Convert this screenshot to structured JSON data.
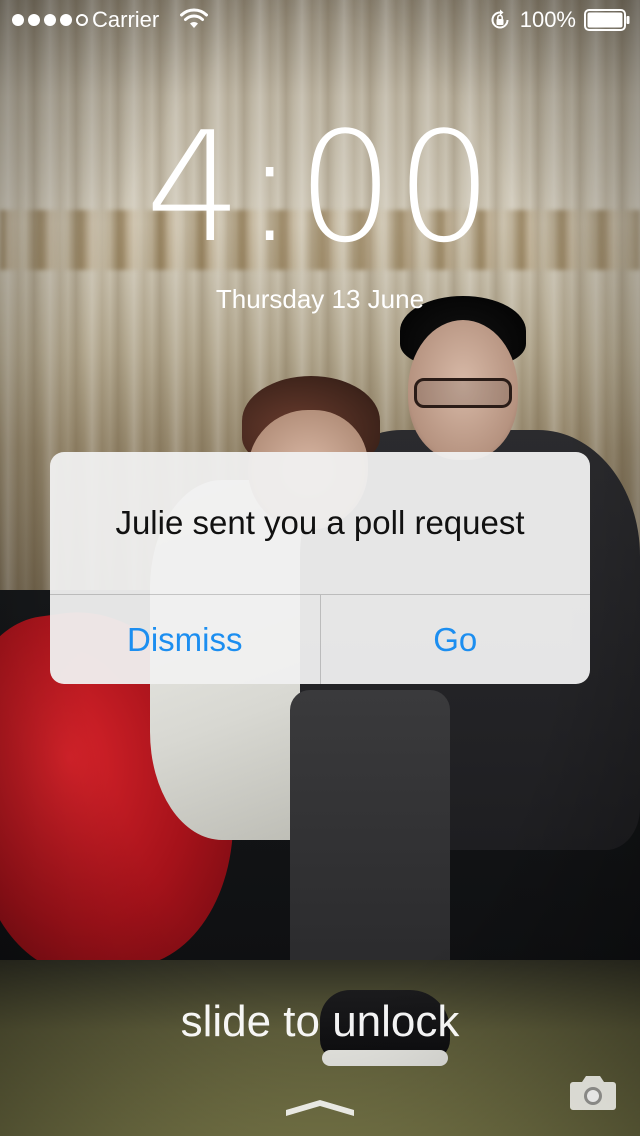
{
  "status_bar": {
    "signal_bars_filled": 4,
    "signal_bars_total": 5,
    "carrier": "Carrier",
    "wifi_icon": "wifi-icon",
    "rotation_lock_icon": "rotation-lock-icon",
    "battery_percent": "100%",
    "battery_level": 1.0
  },
  "lock_screen": {
    "time": "4:00",
    "date": "Thursday 13 June",
    "slide_text": "slide to unlock",
    "grabber_icon": "chevron-up-grabber-icon",
    "camera_icon": "camera-icon"
  },
  "alert": {
    "message": "Julie sent you a poll request",
    "buttons": {
      "dismiss": "Dismiss",
      "go": "Go"
    }
  },
  "colors": {
    "accent": "#1c8ef0",
    "text_on_wallpaper": "#ffffff"
  }
}
